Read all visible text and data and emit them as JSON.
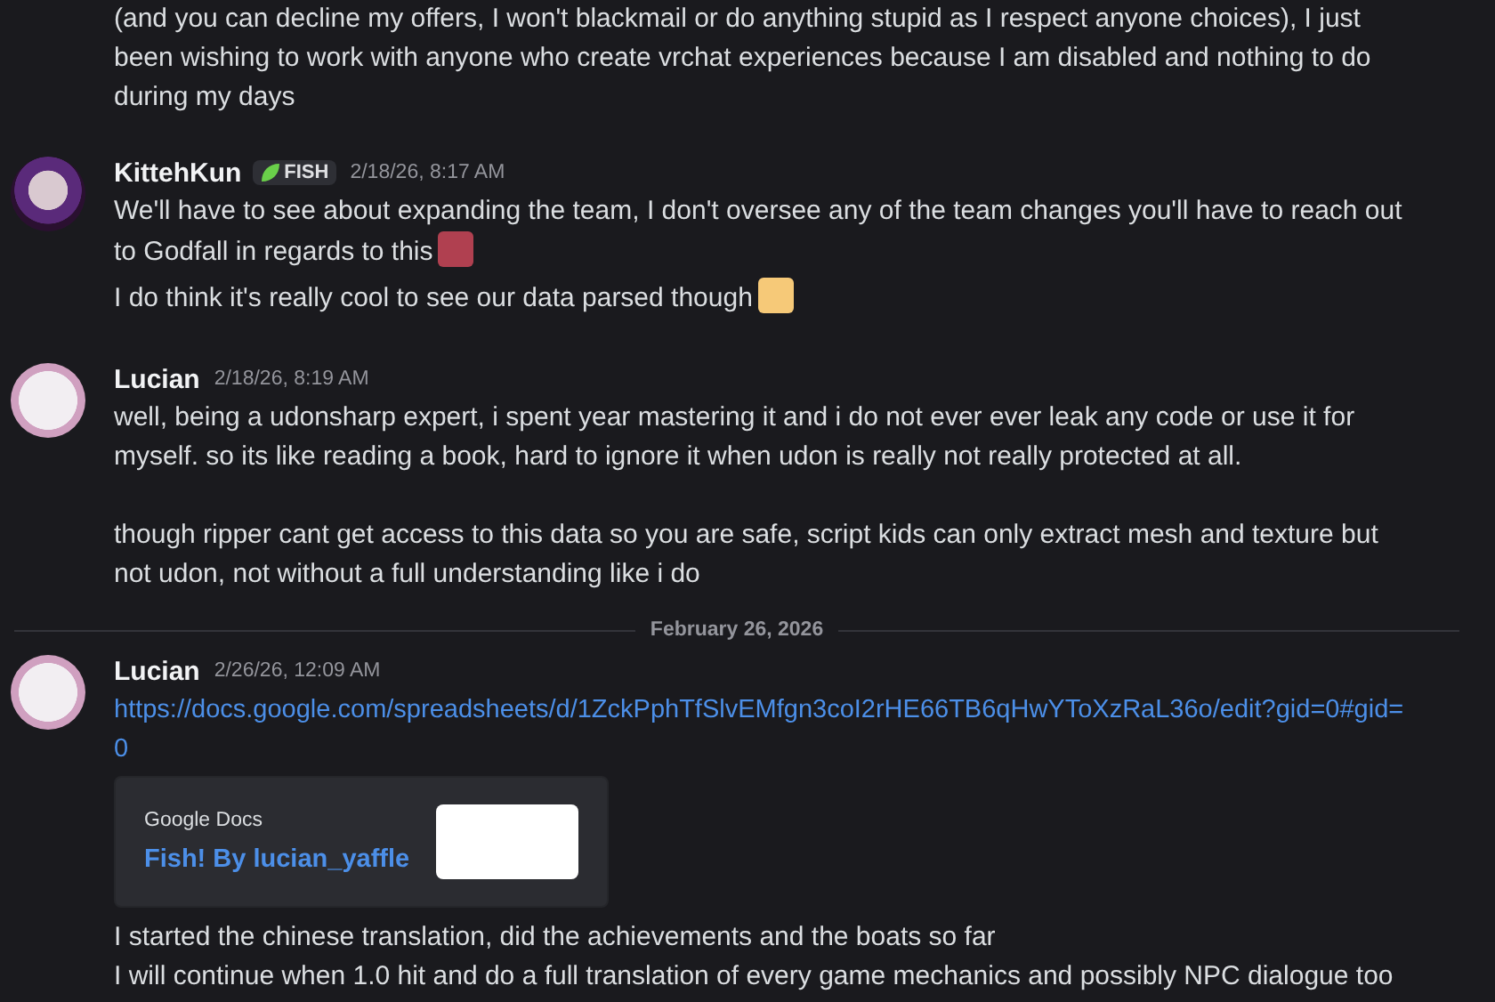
{
  "messages": [
    {
      "kind": "continuation",
      "paragraphs": [
        {
          "text": "(and you can decline my offers, I won't blackmail or do anything stupid as I respect anyone choices), I just been wishing to work with anyone who create vrchat experiences because I am disabled and nothing to do during my days"
        }
      ]
    },
    {
      "kind": "message",
      "author": "KittehKun",
      "badge": "FISH",
      "time": "2/18/26, 8:17 AM",
      "paragraphs": [
        {
          "text": "We'll have to see about expanding the team, I don't oversee any of the team changes you'll have to reach out to Godfall in regards to this",
          "emoji": true
        },
        {
          "text": "I do think it's really cool to see our data parsed though",
          "emoji": true
        }
      ]
    },
    {
      "kind": "message",
      "author": "Lucian",
      "time": "2/18/26, 8:19 AM",
      "paragraphs": [
        {
          "text": "well, being a udonsharp expert, i spent year mastering it and i do not ever ever leak any code or use it for myself. so its like reading a book, hard to ignore it when udon is really not really protected at all."
        },
        {
          "text": "though ripper cant get access to this data so you are safe, script kids can only extract mesh and texture but not udon, not without a full understanding like i do",
          "blank_before": true
        }
      ]
    },
    {
      "kind": "divider",
      "label": "February 26, 2026"
    },
    {
      "kind": "message",
      "author": "Lucian",
      "time": "2/26/26, 12:09 AM",
      "link": "https://docs.google.com/spreadsheets/d/1ZckPphTfSlvEMfgn3coI2rHE66TB6qHwYToXzRaL36o/edit?gid=0#gid=0",
      "embed": {
        "provider": "Google Docs",
        "title": "Fish! By lucian_yaffle"
      },
      "paragraphs": [
        {
          "text": "I started the chinese translation, did the achievements and the boats so far"
        },
        {
          "text": "I will continue when 1.0 hit and do a full translation of every game mechanics and possibly NPC dialogue too"
        }
      ]
    }
  ]
}
